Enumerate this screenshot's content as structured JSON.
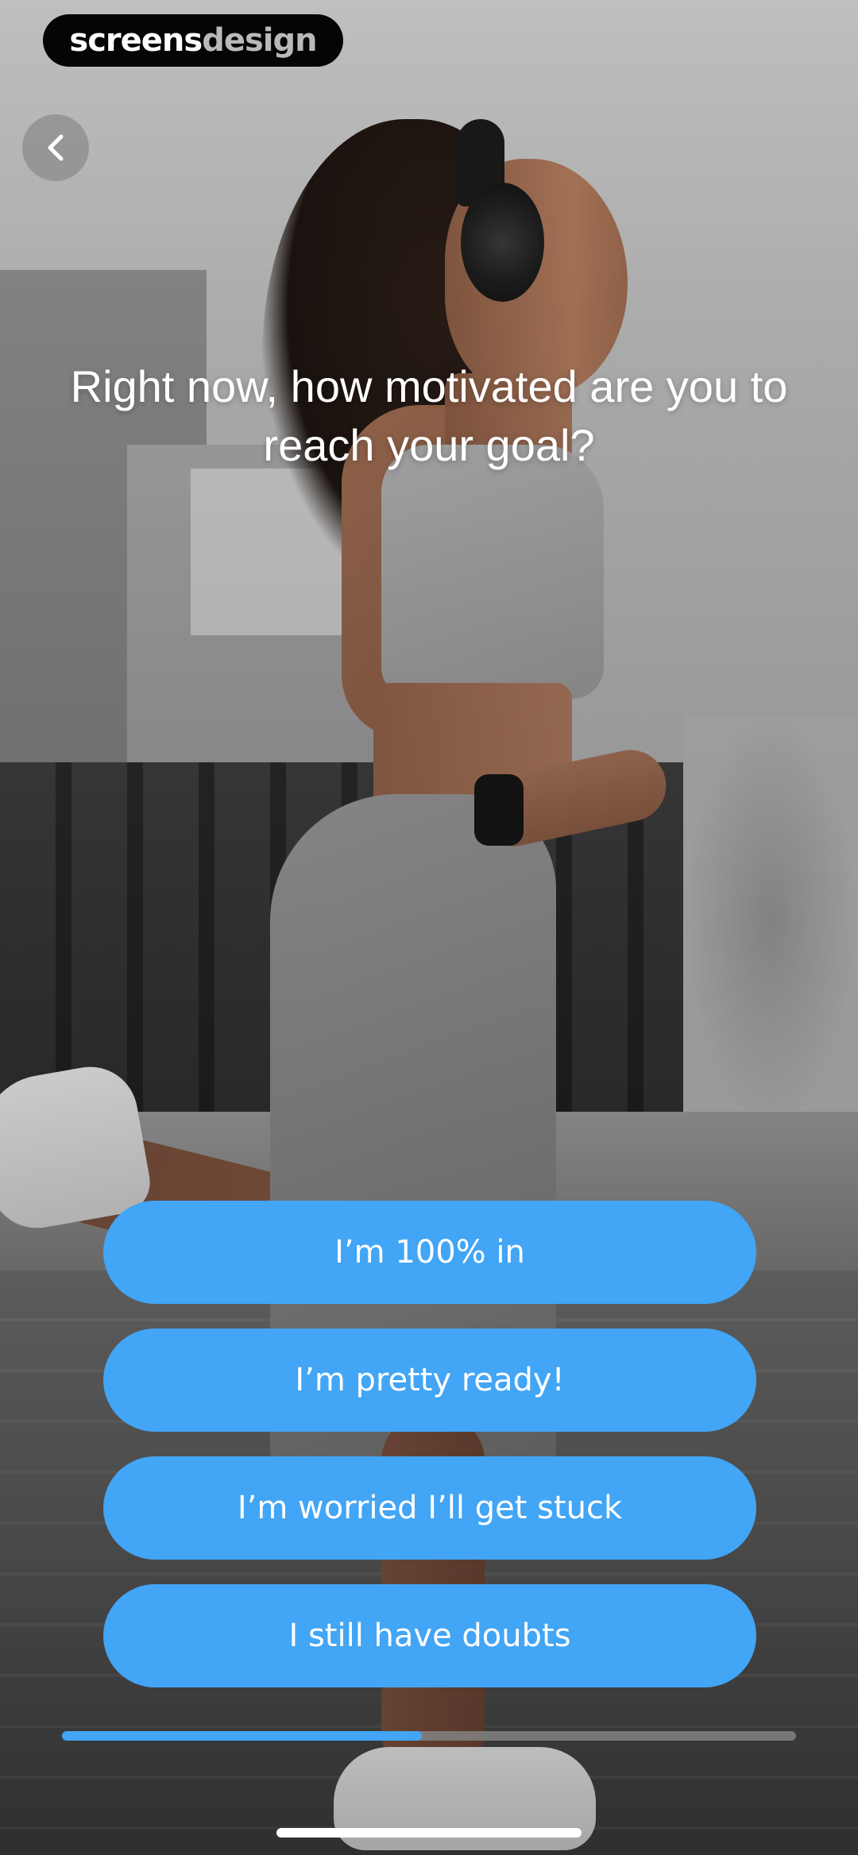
{
  "brand": {
    "part1": "screens",
    "part2": "design"
  },
  "header": {
    "back_icon": "chevron-left-icon"
  },
  "question": {
    "text": "Right now, how motivated are you to reach your goal?"
  },
  "options": [
    {
      "label": "I’m 100% in"
    },
    {
      "label": "I’m pretty ready!"
    },
    {
      "label": "I’m worried I’ll get stuck"
    },
    {
      "label": "I still have doubts"
    }
  ],
  "progress": {
    "fraction": 0.49
  },
  "colors": {
    "accent": "#42a5f5",
    "track": "#828282"
  }
}
